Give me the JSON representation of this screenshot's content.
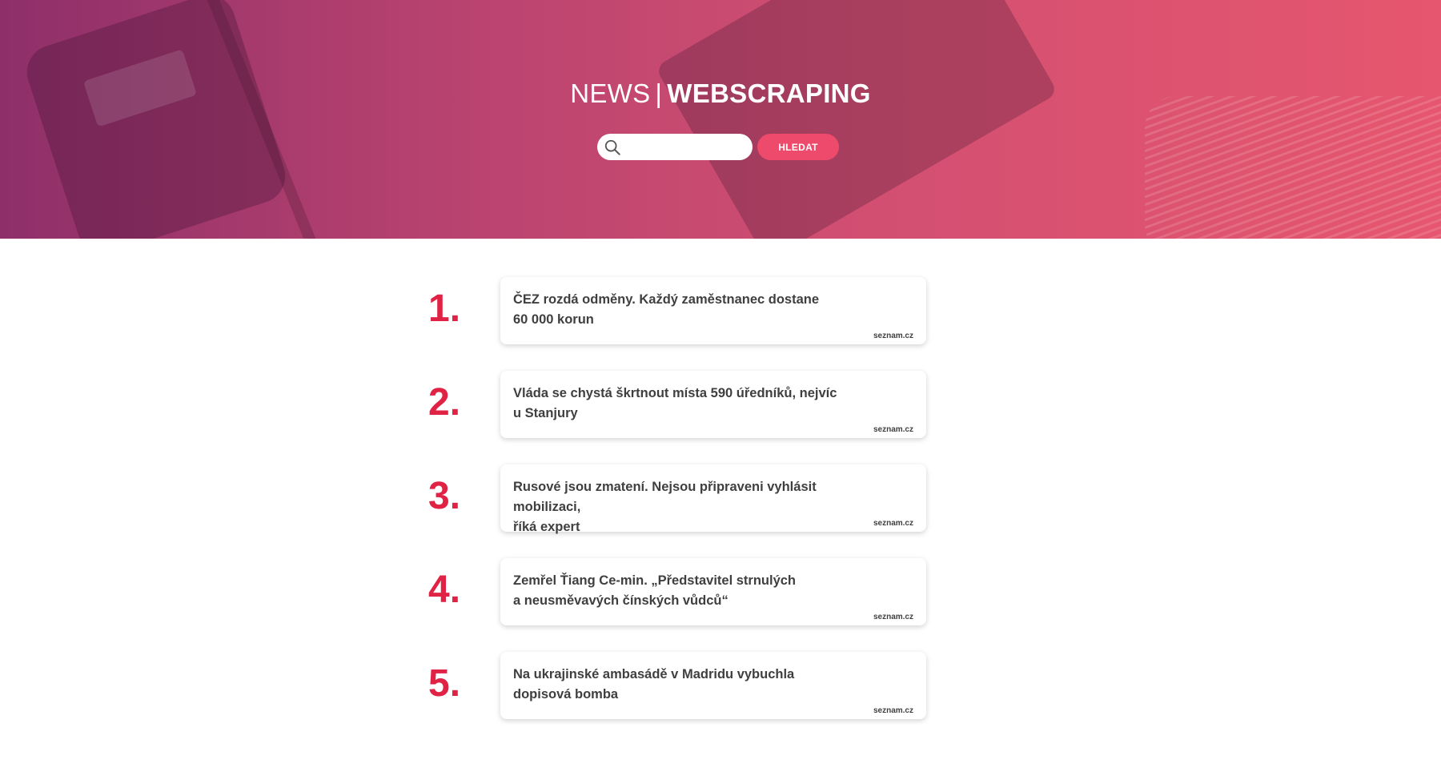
{
  "header": {
    "title_prefix": "NEWS",
    "title_separator": "|",
    "title_main": "WEBSCRAPING"
  },
  "search": {
    "value": "",
    "placeholder": "",
    "button_label": "HLEDAT"
  },
  "colors": {
    "accent": "#e02244",
    "button": "#ee4a6b",
    "hero_gradient_start": "#8e2f6a",
    "hero_gradient_end": "#e6566e"
  },
  "icons": {
    "search": "search-icon"
  },
  "news": [
    {
      "rank": "1.",
      "title_line1": "ČEZ rozdá odměny. Každý zaměstnanec dostane",
      "title_line2": "60 000 korun",
      "source": "seznam.cz"
    },
    {
      "rank": "2.",
      "title_line1": "Vláda se chystá škrtnout místa 590 úředníků, nejvíc",
      "title_line2": "u Stanjury",
      "source": "seznam.cz"
    },
    {
      "rank": "3.",
      "title_line1": "Rusové jsou zmatení. Nejsou připraveni vyhlásit mobilizaci,",
      "title_line2": "říká expert",
      "source": "seznam.cz"
    },
    {
      "rank": "4.",
      "title_line1": "Zemřel Ťiang Ce-min. „Představitel strnulých",
      "title_line2": "a neusměvavých čínských vůdců“",
      "source": "seznam.cz"
    },
    {
      "rank": "5.",
      "title_line1": "Na ukrajinské ambasádě v Madridu vybuchla",
      "title_line2": "dopisová bomba",
      "source": "seznam.cz"
    }
  ]
}
